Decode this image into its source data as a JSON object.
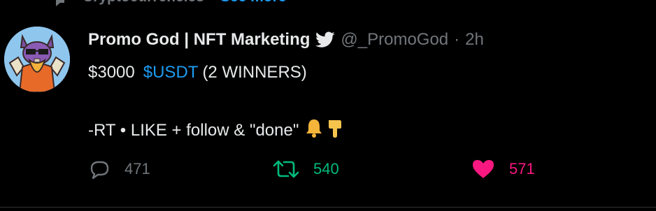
{
  "context": {
    "topic": "Cryptocurrencies",
    "separator": "·",
    "see_more": "See more"
  },
  "tweet": {
    "display_name": "Promo God | NFT Marketing",
    "handle": "@_PromoGod",
    "dot": "·",
    "time": "2h",
    "line1_amount": "$3000",
    "line1_cashtag": "$USDT",
    "line1_rest": "(2 WINNERS)",
    "line2_text": "-RT • LIKE + follow  & \"done\""
  },
  "actions": {
    "reply_count": "471",
    "retweet_count": "540",
    "like_count": "571"
  },
  "colors": {
    "background": "#000000",
    "text": "#e7e9ea",
    "muted": "#71767b",
    "link": "#1d9bf0",
    "retweet": "#00ba7c",
    "like": "#f91880"
  }
}
